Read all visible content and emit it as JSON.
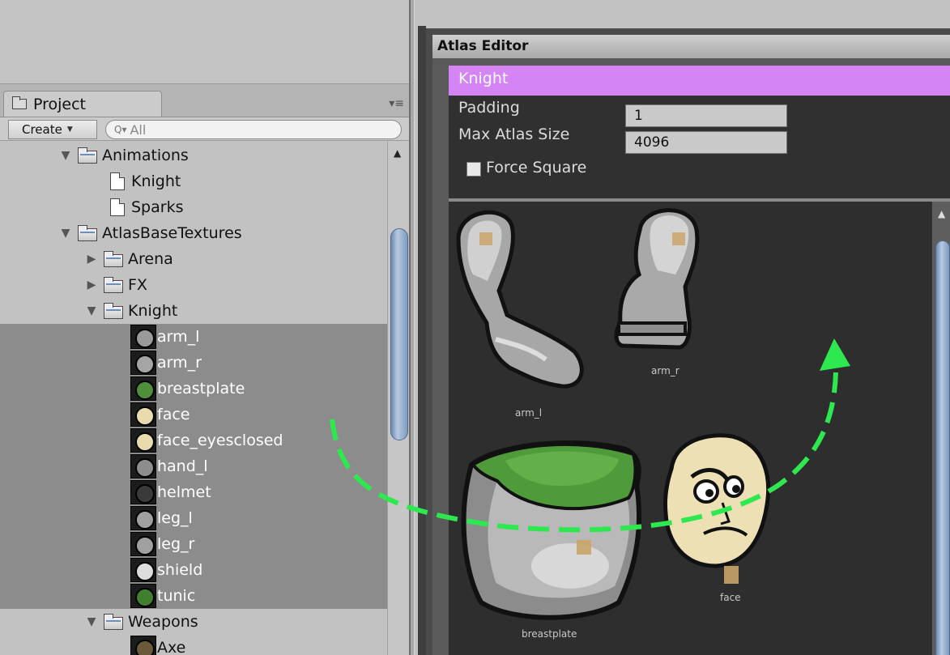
{
  "project_panel": {
    "tab_label": "Project",
    "create_label": "Create",
    "search_placeholder": "All",
    "tree": [
      {
        "label": "Animations",
        "type": "folder",
        "indent": 1,
        "expanded": true
      },
      {
        "label": "Knight",
        "type": "file",
        "indent": 2
      },
      {
        "label": "Sparks",
        "type": "file",
        "indent": 2
      },
      {
        "label": "AtlasBaseTextures",
        "type": "folder",
        "indent": 1,
        "expanded": true
      },
      {
        "label": "Arena",
        "type": "folder",
        "indent": 2,
        "expanded": false
      },
      {
        "label": "FX",
        "type": "folder",
        "indent": 2,
        "expanded": false
      },
      {
        "label": "Knight",
        "type": "folder",
        "indent": 2,
        "expanded": true
      },
      {
        "label": "arm_l",
        "type": "texture",
        "indent": 3,
        "selected": true,
        "color": "#9a9a9a"
      },
      {
        "label": "arm_r",
        "type": "texture",
        "indent": 3,
        "selected": true,
        "color": "#a5a5a5"
      },
      {
        "label": "breastplate",
        "type": "texture",
        "indent": 3,
        "selected": true,
        "color": "#4f8f3a"
      },
      {
        "label": "face",
        "type": "texture",
        "indent": 3,
        "selected": true,
        "color": "#e8dcae"
      },
      {
        "label": "face_eyesclosed",
        "type": "texture",
        "indent": 3,
        "selected": true,
        "color": "#e8dcae"
      },
      {
        "label": "hand_l",
        "type": "texture",
        "indent": 3,
        "selected": true,
        "color": "#8d8d8d"
      },
      {
        "label": "helmet",
        "type": "texture",
        "indent": 3,
        "selected": true,
        "color": "#3a3a3a"
      },
      {
        "label": "leg_l",
        "type": "texture",
        "indent": 3,
        "selected": true,
        "color": "#a0a0a0"
      },
      {
        "label": "leg_r",
        "type": "texture",
        "indent": 3,
        "selected": true,
        "color": "#a0a0a0"
      },
      {
        "label": "shield",
        "type": "texture",
        "indent": 3,
        "selected": true,
        "color": "#dddddd"
      },
      {
        "label": "tunic",
        "type": "texture",
        "indent": 3,
        "selected": true,
        "color": "#3f7f2e"
      },
      {
        "label": "Weapons",
        "type": "folder",
        "indent": 2,
        "expanded": true
      },
      {
        "label": "Axe",
        "type": "texture",
        "indent": 3,
        "selected": false,
        "color": "#6a5a3a"
      }
    ]
  },
  "atlas_editor": {
    "window_title": "Atlas Editor",
    "atlas_name": "Knight",
    "padding_label": "Padding",
    "padding_value": "1",
    "max_size_label": "Max Atlas Size",
    "max_size_value": "4096",
    "force_square_label": "Force Square",
    "force_square_checked": false,
    "sprite_labels": {
      "arm_l": "arm_l",
      "arm_r": "arm_r",
      "breastplate": "breastplate",
      "face": "face"
    }
  },
  "colors": {
    "header_accent": "#d484f4",
    "drag_arrow": "#2ee84f",
    "selection": "#8c8c8c"
  }
}
